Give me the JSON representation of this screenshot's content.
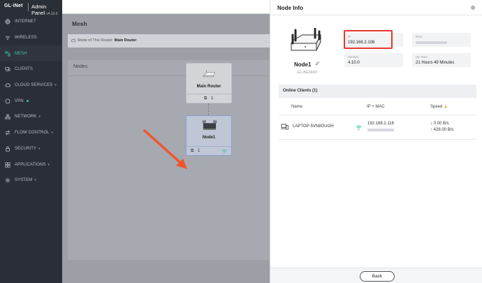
{
  "app": {
    "logo": "GL·iNet",
    "title": "Admin Panel",
    "version": "v4.10.0"
  },
  "sidebar": {
    "items": [
      {
        "label": "INTERNET",
        "icon": "globe-icon"
      },
      {
        "label": "WIRELESS",
        "icon": "wifi-icon"
      },
      {
        "label": "MESH",
        "icon": "mesh-icon",
        "active": true
      },
      {
        "label": "CLIENTS",
        "icon": "devices-icon"
      },
      {
        "label": "CLOUD SERVICES",
        "icon": "cloud-icon",
        "expandable": true
      },
      {
        "label": "VPN",
        "icon": "vpn-icon",
        "expandable": true,
        "status_dot": true
      },
      {
        "label": "NETWORK",
        "icon": "network-icon",
        "expandable": true
      },
      {
        "label": "FLOW CONTROL",
        "icon": "flow-icon",
        "expandable": true
      },
      {
        "label": "SECURITY",
        "icon": "shield-icon",
        "expandable": true
      },
      {
        "label": "APPLICATIONS",
        "icon": "apps-icon",
        "expandable": true
      },
      {
        "label": "SYSTEM",
        "icon": "gear-icon",
        "expandable": true
      }
    ]
  },
  "main": {
    "title": "Mesh",
    "mode_label": "Mode of This Router:",
    "mode_value": "Main Router",
    "nodes_label": "Nodes",
    "main_router": {
      "name": "Main Router",
      "clients": "1"
    },
    "node1": {
      "name": "Node1",
      "clients": "1"
    }
  },
  "panel": {
    "title": "Node Info",
    "node_name": "Node1",
    "node_model": "GL-BE3600",
    "ip": {
      "label": "IP",
      "value": "192.168.2.108"
    },
    "mac": {
      "label": "MAC",
      "value": ""
    },
    "version": {
      "label": "Version",
      "value": "4.10.0"
    },
    "uptime": {
      "label": "Up Time",
      "value": "21 Hours 49 Minutes"
    },
    "clients_title": "Online Clients (1)",
    "columns": {
      "name": "Name",
      "ip_mac": "IP + MAC",
      "speed": "Speed"
    },
    "clients": [
      {
        "name": "LAPTOP-5VN8OUOH",
        "ip": "192.168.2.116",
        "down": "0.00 B/s",
        "up": "428.00 B/s"
      }
    ],
    "back_label": "Back"
  },
  "colors": {
    "accent": "#3fbfa6",
    "highlight": "#e4372a",
    "arrow": "#f0552f"
  }
}
